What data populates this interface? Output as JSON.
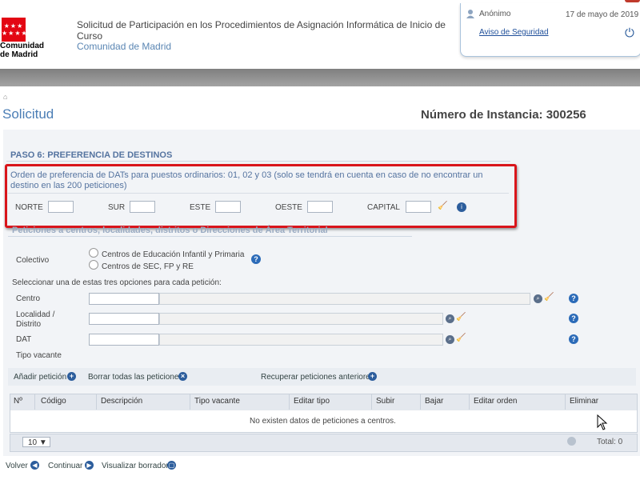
{
  "header": {
    "logo_text": "Comunidad\nde Madrid",
    "logo_stars": "★★★\n★★★★",
    "app_title": "Solicitud de Participación en los Procedimientos de Asignación Informática de Inicio de Curso",
    "app_subtitle": "Comunidad de Madrid",
    "user": "Anónimo",
    "date": "17 de mayo de 2019",
    "security_link": "Aviso de Seguridad",
    "power_icon": "power-icon"
  },
  "page": {
    "title": "Solicitud",
    "instance": "Número de Instancia: 300256"
  },
  "step": {
    "title": "PASO 6: PREFERENCIA DE DESTINOS",
    "dat_text": "Orden de preferencia de DATs para puestos ordinarios: 01, 02 y 03 (solo se tendrá en cuenta en caso de no encontrar un destino en las 200 peticiones)",
    "zones": [
      {
        "label": "NORTE",
        "value": ""
      },
      {
        "label": "SUR",
        "value": ""
      },
      {
        "label": "ESTE",
        "value": ""
      },
      {
        "label": "OESTE",
        "value": ""
      },
      {
        "label": "CAPITAL",
        "value": ""
      }
    ]
  },
  "peticiones": {
    "title": "Peticiones a centros, localidades, distritos o Direcciones de Área Territorial",
    "colectivo_label": "Colectivo",
    "colectivo_options": [
      "Centros de Educación Infantil y Primaria",
      "Centros de SEC, FP y RE"
    ],
    "instruction": "Seleccionar una de estas tres opciones para cada petición:",
    "fields": [
      {
        "label": "Centro"
      },
      {
        "label": "Localidad / Distrito"
      },
      {
        "label": "DAT"
      }
    ],
    "tipo_vacante": "Tipo vacante"
  },
  "actions": {
    "add": "Añadir petición",
    "delete_all": "Borrar todas las peticiones",
    "recover": "Recuperar peticiones anteriores"
  },
  "table": {
    "columns": [
      "Nº",
      "Código",
      "Descripción",
      "Tipo vacante",
      "Editar tipo",
      "Subir",
      "Bajar",
      "Editar orden",
      "Eliminar"
    ],
    "empty_message": "No existen datos de peticiones a centros.",
    "page_size": "10 ▼",
    "total": "Total: 0"
  },
  "footer": {
    "back": "Volver",
    "continue": "Continuar",
    "preview": "Visualizar borrador"
  },
  "colors": {
    "accent": "#4a7db5",
    "highlight": "#d9151b",
    "brand": "#e30613"
  }
}
